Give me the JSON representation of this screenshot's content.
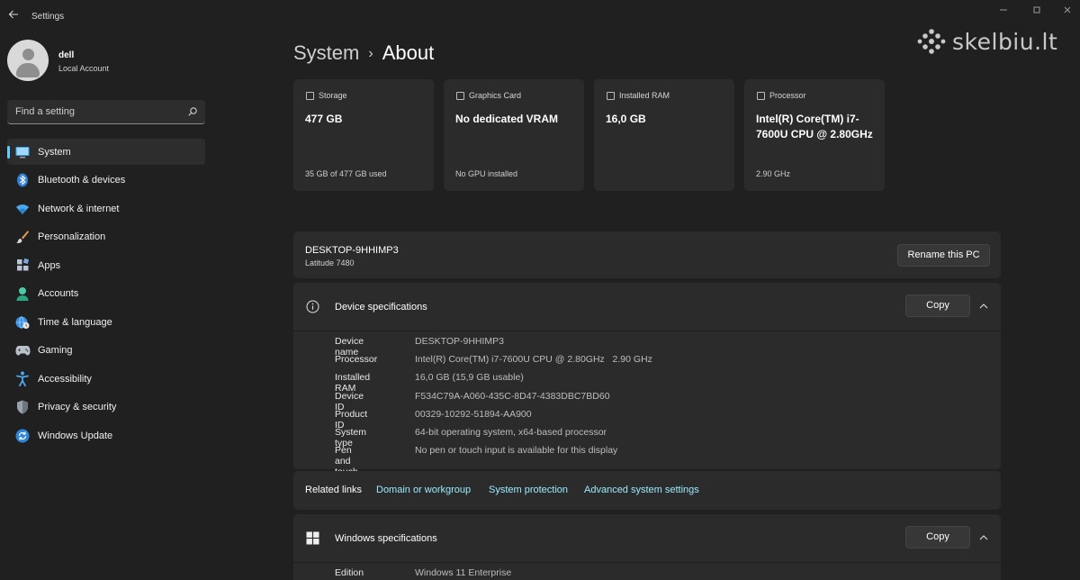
{
  "window": {
    "title": "Settings"
  },
  "user": {
    "name": "dell",
    "account_type": "Local Account"
  },
  "search": {
    "placeholder": "Find a setting"
  },
  "watermark": {
    "text": "skelbiu.lt"
  },
  "nav": [
    {
      "label": "System",
      "icon": "monitor-icon",
      "active": true
    },
    {
      "label": "Bluetooth & devices",
      "icon": "bluetooth-icon"
    },
    {
      "label": "Network & internet",
      "icon": "wifi-icon"
    },
    {
      "label": "Personalization",
      "icon": "brush-icon"
    },
    {
      "label": "Apps",
      "icon": "apps-icon"
    },
    {
      "label": "Accounts",
      "icon": "person-icon"
    },
    {
      "label": "Time & language",
      "icon": "globe-clock-icon"
    },
    {
      "label": "Gaming",
      "icon": "gamepad-icon"
    },
    {
      "label": "Accessibility",
      "icon": "accessibility-icon"
    },
    {
      "label": "Privacy & security",
      "icon": "shield-icon"
    },
    {
      "label": "Windows Update",
      "icon": "update-icon"
    }
  ],
  "breadcrumb": {
    "parent": "System",
    "separator": "›",
    "current": "About"
  },
  "cards": [
    {
      "title": "Storage",
      "value": "477 GB",
      "sub": "35 GB of 477 GB used"
    },
    {
      "title": "Graphics Card",
      "value": "No dedicated VRAM",
      "sub": "No GPU installed"
    },
    {
      "title": "Installed RAM",
      "value": "16,0 GB",
      "sub": ""
    },
    {
      "title": "Processor",
      "value": "Intel(R) Core(TM) i7-7600U CPU @ 2.80GHz",
      "sub": "2.90 GHz"
    }
  ],
  "pc": {
    "name": "DESKTOP-9HHIMP3",
    "model": "Latitude 7480",
    "rename_label": "Rename this PC"
  },
  "device_specs": {
    "title": "Device specifications",
    "copy_label": "Copy",
    "rows": [
      {
        "key": "Device name",
        "value": "DESKTOP-9HHIMP3"
      },
      {
        "key": "Processor",
        "value": "Intel(R) Core(TM) i7-7600U CPU @ 2.80GHz   2.90 GHz"
      },
      {
        "key": "Installed RAM",
        "value": "16,0 GB (15,9 GB usable)"
      },
      {
        "key": "Device ID",
        "value": "F534C79A-A060-435C-8D47-4383DBC7BD60"
      },
      {
        "key": "Product ID",
        "value": "00329-10292-51894-AA900"
      },
      {
        "key": "System type",
        "value": "64-bit operating system, x64-based processor"
      },
      {
        "key": "Pen and touch",
        "value": "No pen or touch input is available for this display"
      }
    ]
  },
  "related": {
    "label": "Related links",
    "links": [
      "Domain or workgroup",
      "System protection",
      "Advanced system settings"
    ]
  },
  "windows_specs": {
    "title": "Windows specifications",
    "copy_label": "Copy",
    "rows": [
      {
        "key": "Edition",
        "value": "Windows 11 Enterprise"
      }
    ]
  },
  "colors": {
    "accent": "#60cdff",
    "link": "#99ebff",
    "background": "#202020",
    "card": "#2b2b2b"
  }
}
